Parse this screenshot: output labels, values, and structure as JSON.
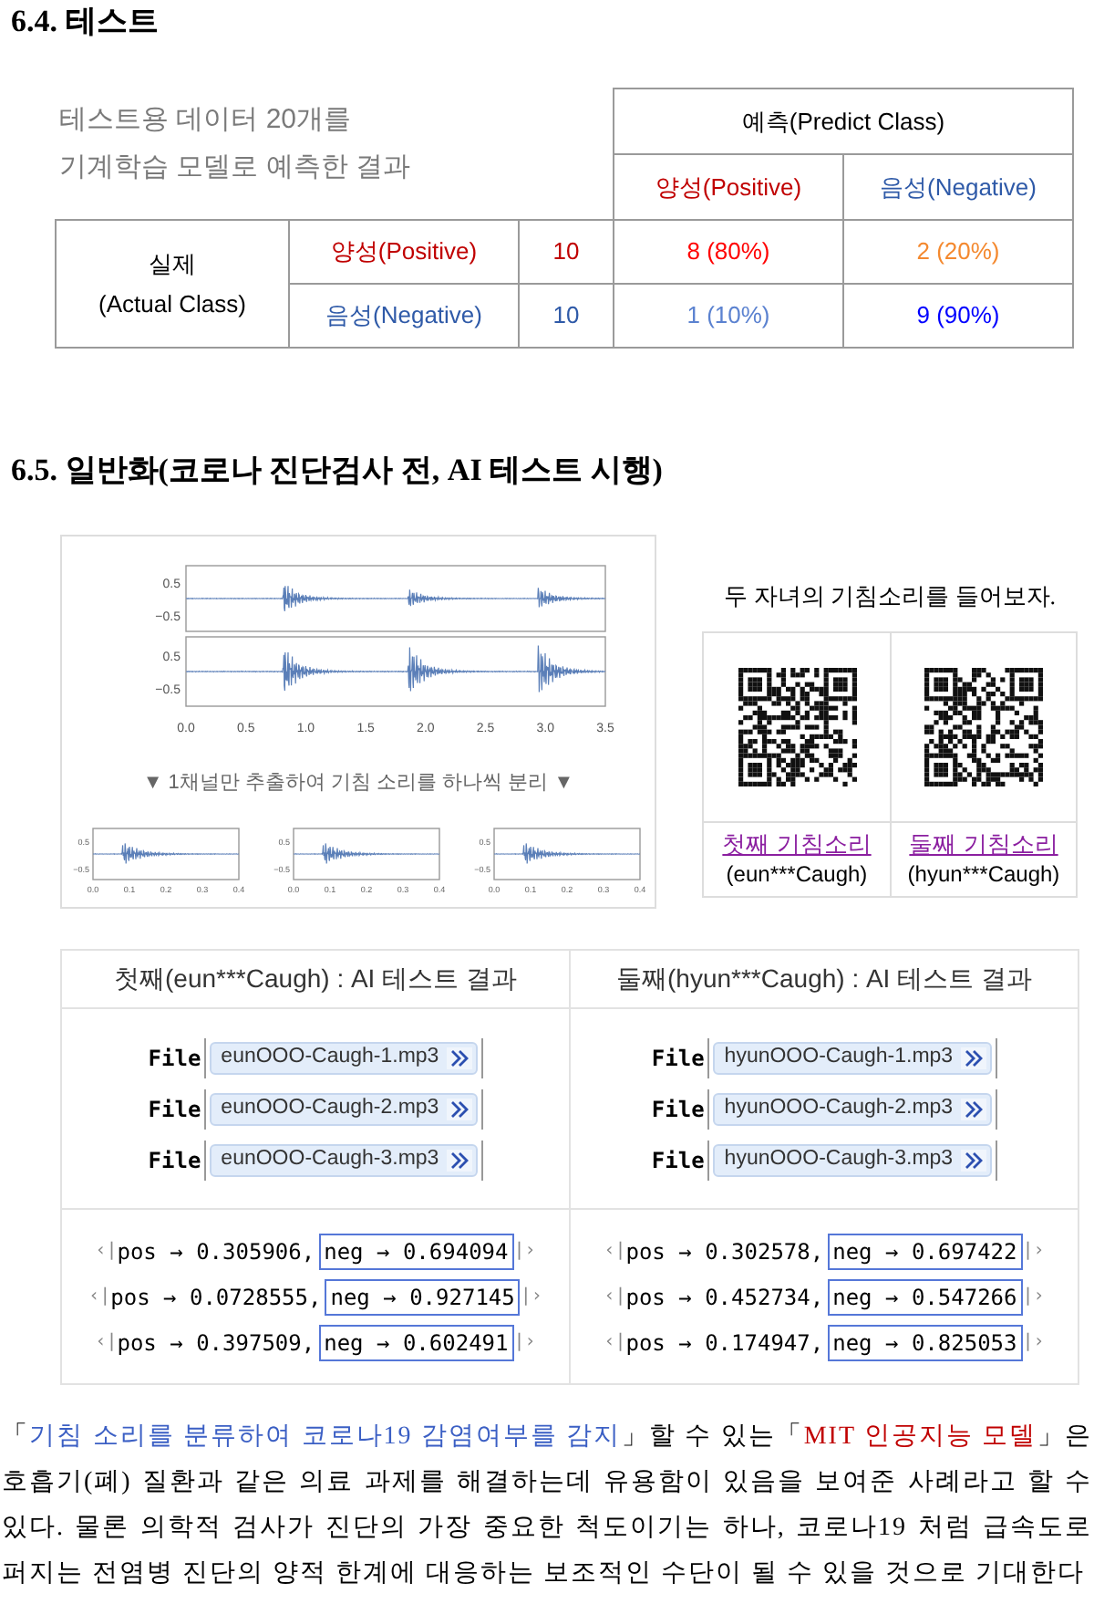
{
  "section_test": {
    "heading": "6.4. 테스트",
    "description_lines": [
      "테스트용 데이터 20개를",
      "기계학습 모델로 예측한 결과"
    ],
    "predicted_header": "예측(Predict Class)",
    "predicted_classes": [
      {
        "label": "양성(Positive)",
        "color": "#c00000"
      },
      {
        "label": "음성(Negative)",
        "color": "#2f5aa8"
      }
    ],
    "actual_header_lines": [
      "실제",
      "(Actual Class)"
    ],
    "rows": [
      {
        "label": "양성(Positive)",
        "color": "#c00000",
        "count": "10",
        "cells": [
          {
            "text": "8 (80%)",
            "color": "#ff0000"
          },
          {
            "text": "2 (20%)",
            "color": "#f4892f"
          }
        ]
      },
      {
        "label": "음성(Negative)",
        "color": "#2f5aa8",
        "count": "10",
        "cells": [
          {
            "text": "1 (10%)",
            "color": "#5b82d0"
          },
          {
            "text": "9 (90%)",
            "color": "#0000ff"
          }
        ]
      }
    ]
  },
  "section_generalization": {
    "heading": "6.5. 일반화(코로나 진단검사 전, AI 테스트 시행)",
    "waveform_figure": {
      "stereo_panels": [
        {
          "yticks": [
            "0.5",
            "−0.5"
          ]
        },
        {
          "yticks": [
            "0.5",
            "−0.5"
          ]
        }
      ],
      "stereo_xticks": [
        "0.0",
        "0.5",
        "1.0",
        "1.5",
        "2.0",
        "2.5",
        "3.0",
        "3.5"
      ],
      "caption": "▼ 1채널만 추출하여 기침 소리를 하나씩 분리 ▼",
      "segments": [
        {
          "yticks": [
            "0.5",
            "−0.5"
          ],
          "xticks": [
            "0.0",
            "0.1",
            "0.2",
            "0.3",
            "0.4"
          ]
        },
        {
          "yticks": [
            "0.5",
            "−0.5"
          ],
          "xticks": [
            "0.0",
            "0.1",
            "0.2",
            "0.3",
            "0.4"
          ]
        },
        {
          "yticks": [
            "0.5",
            "−0.5"
          ],
          "xticks": [
            "0.0",
            "0.1",
            "0.2",
            "0.3",
            "0.4"
          ]
        }
      ]
    },
    "listen_caption": "두 자녀의 기침소리를 들어보자.",
    "qr_cards": [
      {
        "link": "첫째 기침소리",
        "sub": "(eun***Caugh)"
      },
      {
        "link": "둘째 기침소리",
        "sub": "(hyun***Caugh)"
      }
    ],
    "results": [
      {
        "title": "첫째(eun***Caugh) : AI 테스트 결과",
        "files": [
          {
            "keyword": "File",
            "name": "eunOOO-Caugh-1.mp3"
          },
          {
            "keyword": "File",
            "name": "eunOOO-Caugh-2.mp3"
          },
          {
            "keyword": "File",
            "name": "eunOOO-Caugh-3.mp3"
          }
        ],
        "outputs": [
          {
            "open": "‹|",
            "pos": "pos → 0.305906,",
            "neg": "neg → 0.694094",
            "close": "|›"
          },
          {
            "open": "‹|",
            "pos": "pos → 0.0728555,",
            "neg": "neg → 0.927145",
            "close": "|›"
          },
          {
            "open": "‹|",
            "pos": "pos → 0.397509,",
            "neg": "neg → 0.602491",
            "close": "|›"
          }
        ]
      },
      {
        "title": "둘째(hyun***Caugh) : AI 테스트 결과",
        "files": [
          {
            "keyword": "File",
            "name": "hyunOOO-Caugh-1.mp3"
          },
          {
            "keyword": "File",
            "name": "hyunOOO-Caugh-2.mp3"
          },
          {
            "keyword": "File",
            "name": "hyunOOO-Caugh-3.mp3"
          }
        ],
        "outputs": [
          {
            "open": "‹|",
            "pos": "pos → 0.302578,",
            "neg": "neg → 0.697422",
            "close": "|›"
          },
          {
            "open": "‹|",
            "pos": "pos → 0.452734,",
            "neg": "neg → 0.547266",
            "close": "|›"
          },
          {
            "open": "‹|",
            "pos": "pos → 0.174947,",
            "neg": "neg → 0.825053",
            "close": "|›"
          }
        ]
      }
    ],
    "paragraph": [
      {
        "kind": "plain",
        "text": "「"
      },
      {
        "kind": "blue",
        "text": "기침 소리를 분류하여 코로나19 감염여부를 감지"
      },
      {
        "kind": "plain",
        "text": "」할 수 있는「"
      },
      {
        "kind": "red",
        "text": "MIT 인공지능 모델"
      },
      {
        "kind": "plain",
        "text": "」은 호흡기(폐) 질환과 같은 의료 과제를 해결하는데 유용함이 있음을 보여준 사례라고 할 수 있다. 물론 의학적 검사가 진단의 가장 중요한 척도이기는 하나, 코로나19 처럼 급속도로 퍼지는 전염병 진단의 양적 한계에 대응하는 보조적인 수단이 될 수 있을 것으로 기대한다"
      }
    ]
  }
}
